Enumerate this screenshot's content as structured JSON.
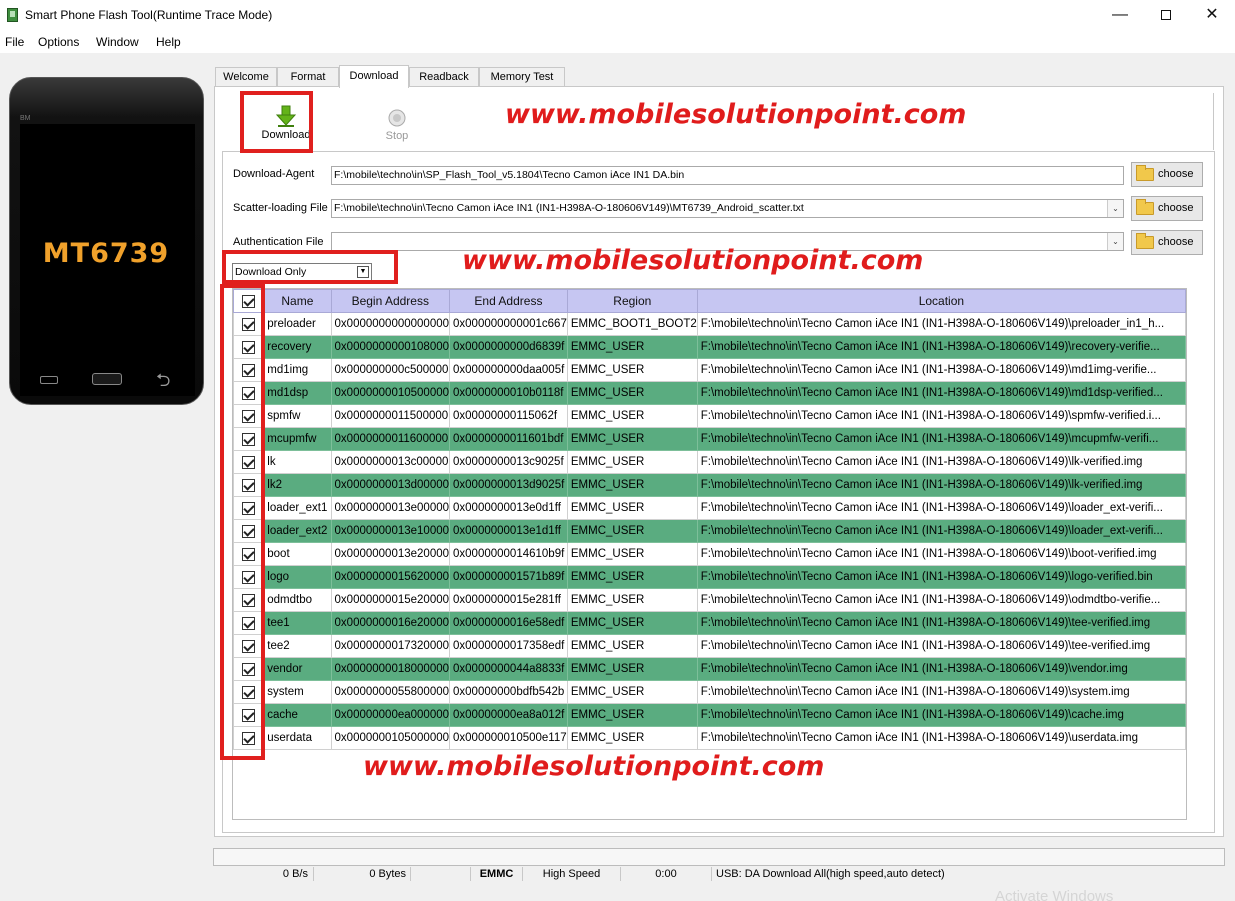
{
  "window": {
    "title": "Smart Phone Flash Tool(Runtime Trace Mode)",
    "minimize": "—",
    "close": "✕"
  },
  "menu": [
    "File",
    "Options",
    "Window",
    "Help"
  ],
  "phone": {
    "brand": "BM",
    "model": "MT6739",
    "back_glyph": "⮌"
  },
  "tabs": [
    "Welcome",
    "Format",
    "Download",
    "Readback",
    "Memory Test"
  ],
  "toolbar": {
    "download_label": "Download",
    "stop_label": "Stop"
  },
  "fields": {
    "download_agent_label": "Download-Agent",
    "download_agent_value": "F:\\mobile\\techno\\in\\SP_Flash_Tool_v5.1804\\Tecno Camon iAce IN1 DA.bin",
    "scatter_label": "Scatter-loading File",
    "scatter_value": "F:\\mobile\\techno\\in\\Tecno Camon iAce IN1 (IN1-H398A-O-180606V149)\\MT6739_Android_scatter.txt",
    "auth_label": "Authentication File",
    "auth_value": "",
    "choose_label": "choose",
    "combo_arrow": "⌄"
  },
  "mode": {
    "selected": "Download Only",
    "arrow": "▼"
  },
  "table": {
    "headers": [
      "Name",
      "Begin Address",
      "End Address",
      "Region",
      "Location"
    ],
    "rows": [
      [
        "preloader",
        "0x0000000000000000",
        "0x000000000001c667",
        "EMMC_BOOT1_BOOT2",
        "F:\\mobile\\techno\\in\\Tecno Camon iAce IN1 (IN1-H398A-O-180606V149)\\preloader_in1_h..."
      ],
      [
        "recovery",
        "0x0000000000108000",
        "0x0000000000d6839f",
        "EMMC_USER",
        "F:\\mobile\\techno\\in\\Tecno Camon iAce IN1 (IN1-H398A-O-180606V149)\\recovery-verifie..."
      ],
      [
        "md1img",
        "0x000000000c500000",
        "0x000000000daa005f",
        "EMMC_USER",
        "F:\\mobile\\techno\\in\\Tecno Camon iAce IN1 (IN1-H398A-O-180606V149)\\md1img-verifie..."
      ],
      [
        "md1dsp",
        "0x0000000010500000",
        "0x0000000010b0118f",
        "EMMC_USER",
        "F:\\mobile\\techno\\in\\Tecno Camon iAce IN1 (IN1-H398A-O-180606V149)\\md1dsp-verified..."
      ],
      [
        "spmfw",
        "0x0000000011500000",
        "0x00000000115062f",
        "EMMC_USER",
        "F:\\mobile\\techno\\in\\Tecno Camon iAce IN1 (IN1-H398A-O-180606V149)\\spmfw-verified.i..."
      ],
      [
        "mcupmfw",
        "0x0000000011600000",
        "0x0000000011601bdf",
        "EMMC_USER",
        "F:\\mobile\\techno\\in\\Tecno Camon iAce IN1 (IN1-H398A-O-180606V149)\\mcupmfw-verifi..."
      ],
      [
        "lk",
        "0x0000000013c00000",
        "0x0000000013c9025f",
        "EMMC_USER",
        "F:\\mobile\\techno\\in\\Tecno Camon iAce IN1 (IN1-H398A-O-180606V149)\\lk-verified.img"
      ],
      [
        "lk2",
        "0x0000000013d00000",
        "0x0000000013d9025f",
        "EMMC_USER",
        "F:\\mobile\\techno\\in\\Tecno Camon iAce IN1 (IN1-H398A-O-180606V149)\\lk-verified.img"
      ],
      [
        "loader_ext1",
        "0x0000000013e00000",
        "0x0000000013e0d1ff",
        "EMMC_USER",
        "F:\\mobile\\techno\\in\\Tecno Camon iAce IN1 (IN1-H398A-O-180606V149)\\loader_ext-verifi..."
      ],
      [
        "loader_ext2",
        "0x0000000013e10000",
        "0x0000000013e1d1ff",
        "EMMC_USER",
        "F:\\mobile\\techno\\in\\Tecno Camon iAce IN1 (IN1-H398A-O-180606V149)\\loader_ext-verifi..."
      ],
      [
        "boot",
        "0x0000000013e20000",
        "0x0000000014610b9f",
        "EMMC_USER",
        "F:\\mobile\\techno\\in\\Tecno Camon iAce IN1 (IN1-H398A-O-180606V149)\\boot-verified.img"
      ],
      [
        "logo",
        "0x0000000015620000",
        "0x000000001571b89f",
        "EMMC_USER",
        "F:\\mobile\\techno\\in\\Tecno Camon iAce IN1 (IN1-H398A-O-180606V149)\\logo-verified.bin"
      ],
      [
        "odmdtbo",
        "0x0000000015e20000",
        "0x0000000015e281ff",
        "EMMC_USER",
        "F:\\mobile\\techno\\in\\Tecno Camon iAce IN1 (IN1-H398A-O-180606V149)\\odmdtbo-verifie..."
      ],
      [
        "tee1",
        "0x0000000016e20000",
        "0x0000000016e58edf",
        "EMMC_USER",
        "F:\\mobile\\techno\\in\\Tecno Camon iAce IN1 (IN1-H398A-O-180606V149)\\tee-verified.img"
      ],
      [
        "tee2",
        "0x0000000017320000",
        "0x0000000017358edf",
        "EMMC_USER",
        "F:\\mobile\\techno\\in\\Tecno Camon iAce IN1 (IN1-H398A-O-180606V149)\\tee-verified.img"
      ],
      [
        "vendor",
        "0x0000000018000000",
        "0x0000000044a8833f",
        "EMMC_USER",
        "F:\\mobile\\techno\\in\\Tecno Camon iAce IN1 (IN1-H398A-O-180606V149)\\vendor.img"
      ],
      [
        "system",
        "0x0000000055800000",
        "0x00000000bdfb542b",
        "EMMC_USER",
        "F:\\mobile\\techno\\in\\Tecno Camon iAce IN1 (IN1-H398A-O-180606V149)\\system.img"
      ],
      [
        "cache",
        "0x00000000ea000000",
        "0x00000000ea8a012f",
        "EMMC_USER",
        "F:\\mobile\\techno\\in\\Tecno Camon iAce IN1 (IN1-H398A-O-180606V149)\\cache.img"
      ],
      [
        "userdata",
        "0x0000000105000000",
        "0x000000010500e117",
        "EMMC_USER",
        "F:\\mobile\\techno\\in\\Tecno Camon iAce IN1 (IN1-H398A-O-180606V149)\\userdata.img"
      ]
    ]
  },
  "watermark": "www.mobilesolutionpoint.com",
  "status": {
    "speed": "0 B/s",
    "bytes": "0 Bytes",
    "storage": "EMMC",
    "mode": "High Speed",
    "time": "0:00",
    "usb": "USB: DA Download All(high speed,auto detect)"
  },
  "activation_text": "Activate Windows",
  "colors": {
    "highlight_row": "#5aac80",
    "header_bg": "#c6c6f2",
    "annotation_red": "#e0201e",
    "download_green": "#63b319"
  }
}
